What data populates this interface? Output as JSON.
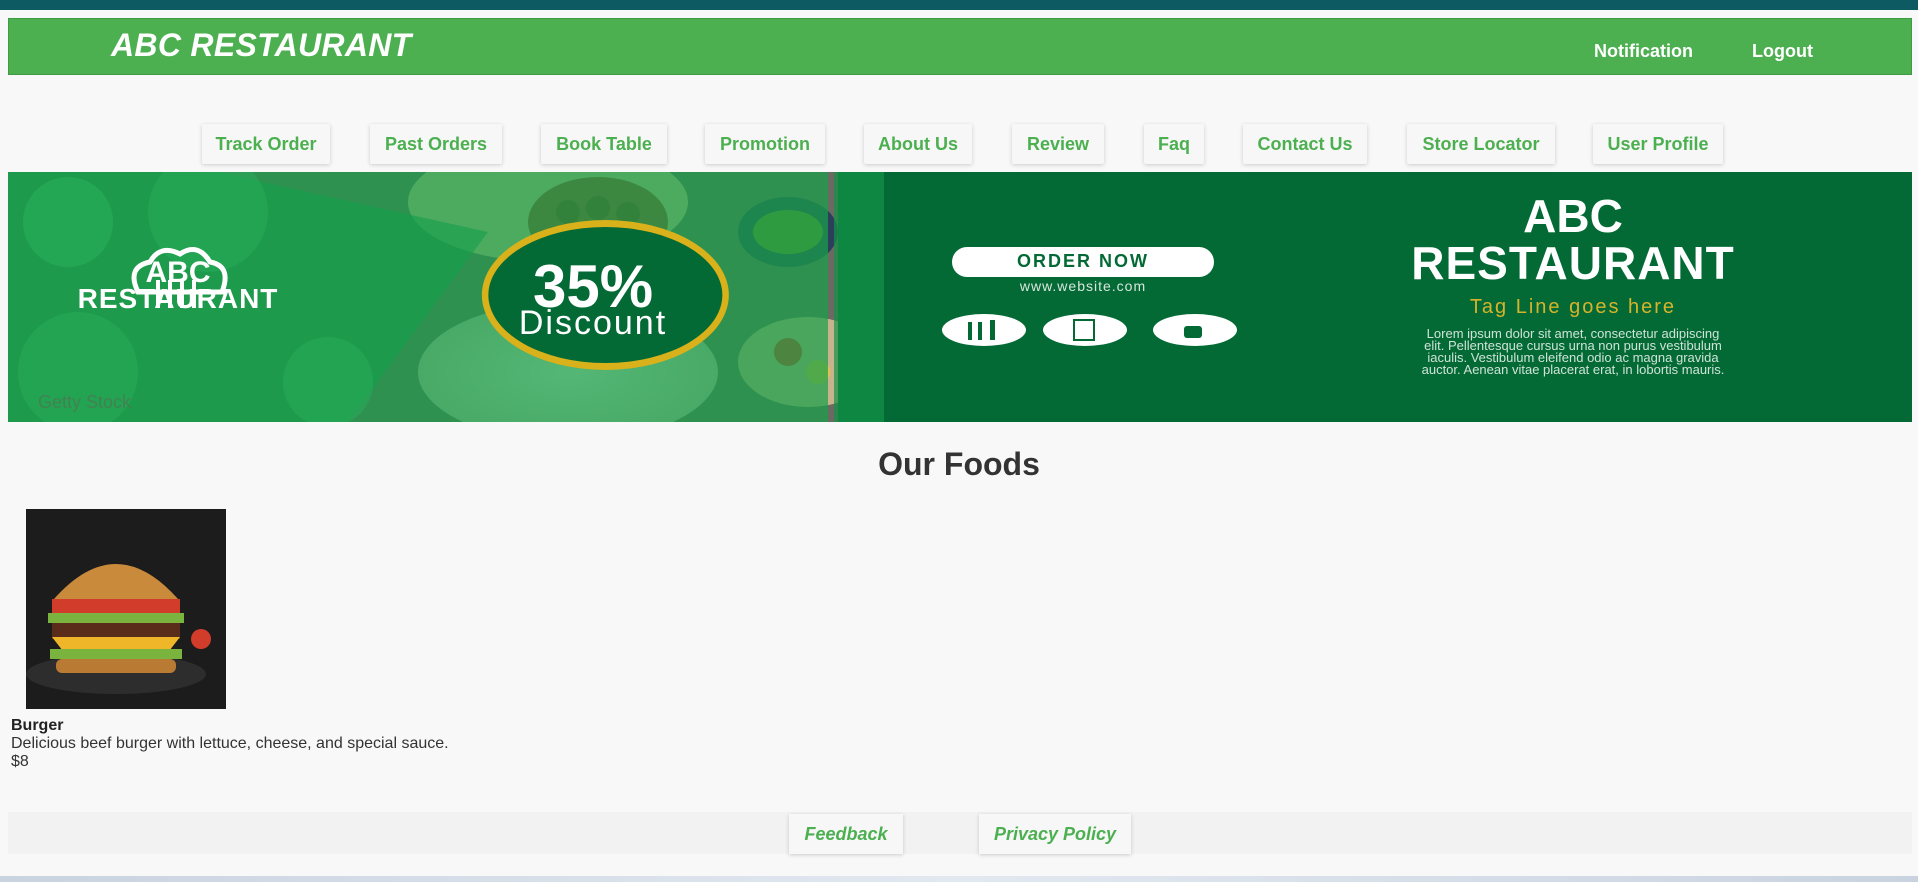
{
  "header": {
    "brand": "ABC RESTAURANT",
    "notification": "Notification",
    "logout": "Logout"
  },
  "nav": [
    "Track Order",
    "Past Orders",
    "Book Table",
    "Promotion",
    "About Us",
    "Review",
    "Faq",
    "Contact Us",
    "Store Locator",
    "User Profile"
  ],
  "banner": {
    "logo_line1": "ABC",
    "logo_line2": "RESTAURANT",
    "discount_value": "35%",
    "discount_label": "Discount",
    "order_now": "ORDER NOW",
    "website": "www.website.com",
    "title_line1": "ABC",
    "title_line2": "RESTAURANT",
    "tagline": "Tag Line goes here",
    "lorem": [
      "Lorem ipsum dolor sit amet, consectetur adipiscing",
      "elit. Pellentesque cursus urna non purus vestibulum",
      "iaculis. Vestibulum eleifend odio ac magna gravida",
      "auctor. Aenean vitae placerat erat, in lobortis mauris."
    ],
    "watermark": "Getty Stock",
    "colors": {
      "dark_green": "#036a36",
      "mid_green": "#1a9a4a",
      "ring_gold": "#d9b11a",
      "tagline": "#d7b32a"
    }
  },
  "main": {
    "title": "Our Foods",
    "foods": [
      {
        "name": "Burger",
        "description": "Delicious beef burger with lettuce, cheese, and special sauce.",
        "price": "$8"
      }
    ]
  },
  "footer": {
    "feedback": "Feedback",
    "privacy": "Privacy Policy"
  },
  "colors": {
    "accent": "#4caf50",
    "top_strip": "#0e5a63"
  }
}
